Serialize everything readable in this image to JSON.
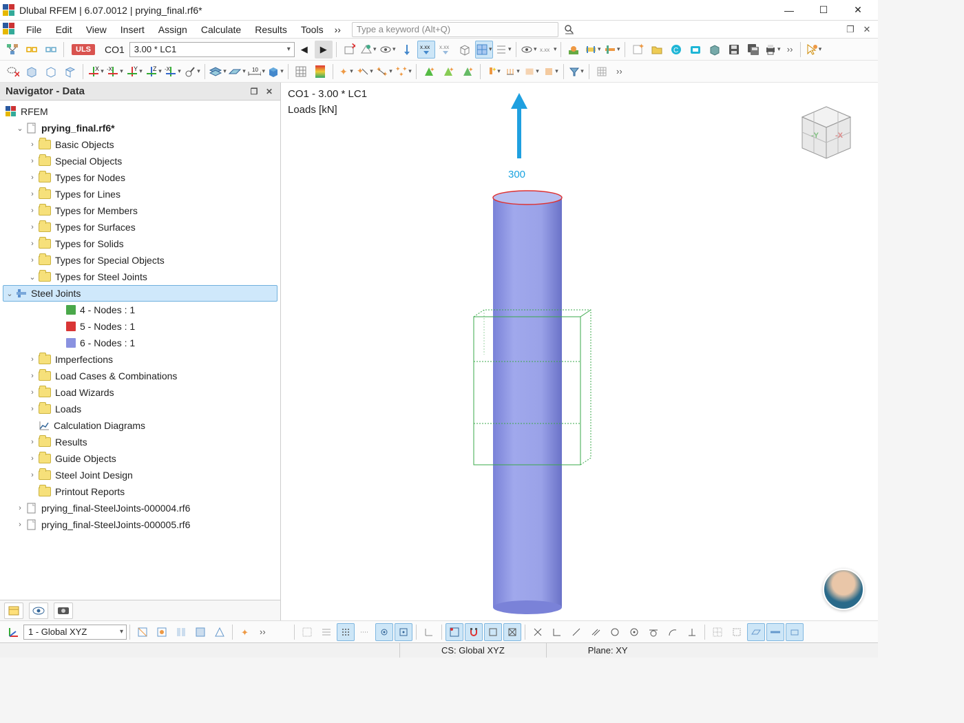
{
  "title": "Dlubal RFEM | 6.07.0012 | prying_final.rf6*",
  "menu": [
    "File",
    "Edit",
    "View",
    "Insert",
    "Assign",
    "Calculate",
    "Results",
    "Tools"
  ],
  "menu_more": "››",
  "search_placeholder": "Type a keyword (Alt+Q)",
  "uls": "ULS",
  "co_label": "CO1",
  "combo_value": "3.00 * LC1",
  "nav_title": "Navigator - Data",
  "root": "RFEM",
  "file": "prying_final.rf6*",
  "tree": {
    "basic": "Basic Objects",
    "special": "Special Objects",
    "tnodes": "Types for Nodes",
    "tlines": "Types for Lines",
    "tmembers": "Types for Members",
    "tsurfaces": "Types for Surfaces",
    "tsolids": "Types for Solids",
    "tspecial": "Types for Special Objects",
    "tsteel": "Types for Steel Joints",
    "steeljoints": "Steel Joints",
    "sj4": "4 - Nodes : 1",
    "sj5": "5 - Nodes : 1",
    "sj6": "6 - Nodes : 1",
    "imperf": "Imperfections",
    "lccombo": "Load Cases & Combinations",
    "lwiz": "Load Wizards",
    "loads": "Loads",
    "calcdiag": "Calculation Diagrams",
    "results": "Results",
    "guide": "Guide Objects",
    "sjdesign": "Steel Joint Design",
    "printout": "Printout Reports",
    "ext1": "prying_final-SteelJoints-000004.rf6",
    "ext2": "prying_final-SteelJoints-000005.rf6"
  },
  "vp_line1": "CO1 - 3.00 * LC1",
  "vp_line2": "Loads [kN]",
  "load_value": "300",
  "sb_cs": "CS: Global XYZ",
  "sb_plane": "Plane: XY",
  "bottom_combo": "1 - Global XYZ"
}
